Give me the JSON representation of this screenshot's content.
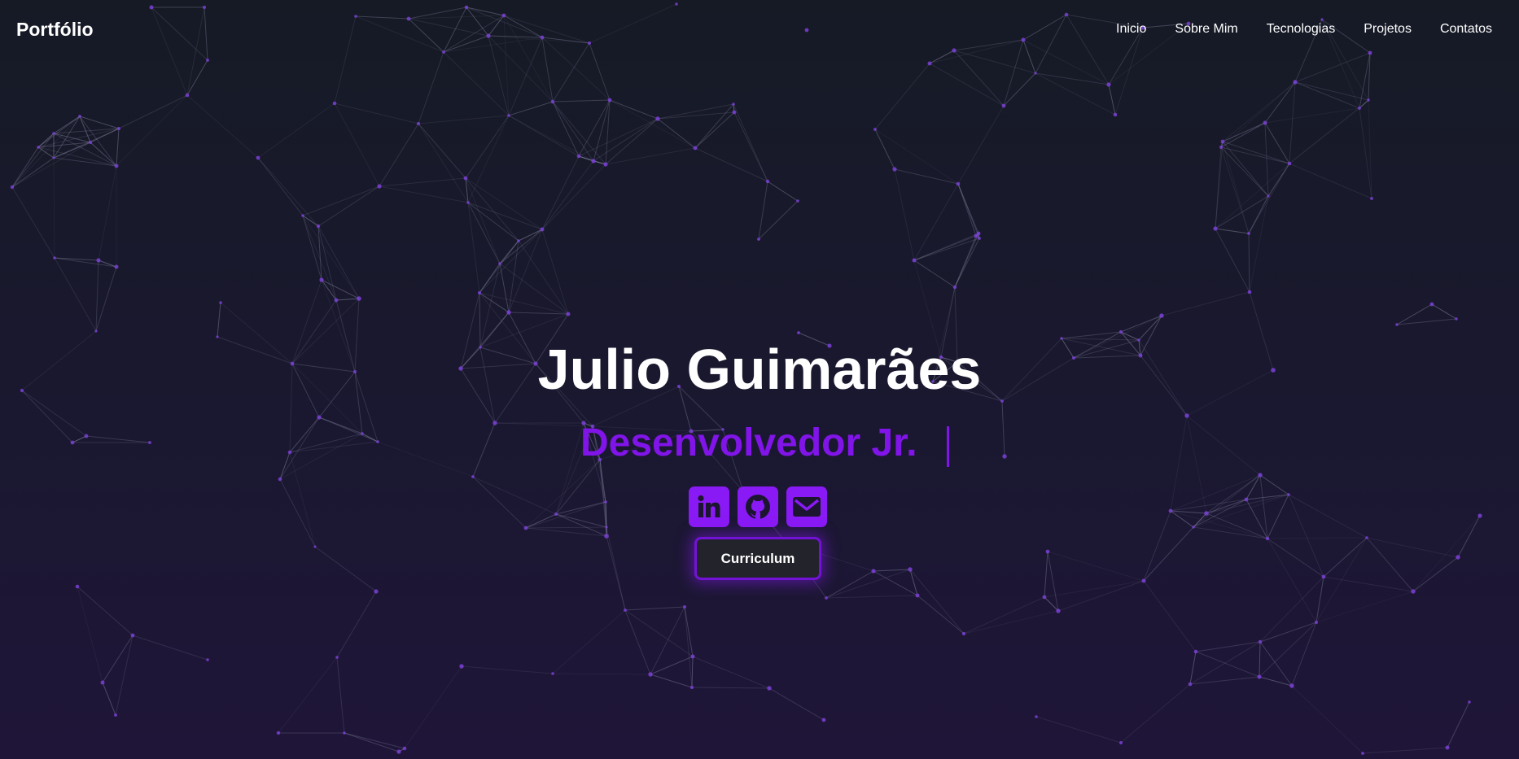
{
  "colors": {
    "background_top": "#161a25",
    "background_bottom": "#1f1538",
    "accent": "#8114e8",
    "icon_bg": "#8a1af5",
    "button_bg": "#23232b",
    "button_border": "#7312d6",
    "text": "#ffffff",
    "network_node": "#7a3fd6",
    "network_line": "#8c8ca8"
  },
  "navbar": {
    "brand": "Portfólio",
    "links": [
      {
        "label": "Inicio"
      },
      {
        "label": "Sobre Mim"
      },
      {
        "label": "Tecnologias"
      },
      {
        "label": "Projetos"
      },
      {
        "label": "Contatos"
      }
    ]
  },
  "hero": {
    "name": "Julio Guimarães",
    "role": "Desenvolvedor Jr.",
    "socials": [
      {
        "icon": "linkedin-icon"
      },
      {
        "icon": "github-icon"
      },
      {
        "icon": "email-icon"
      }
    ],
    "cv_button": "Curriculum"
  },
  "background": {
    "type": "particle-network"
  }
}
